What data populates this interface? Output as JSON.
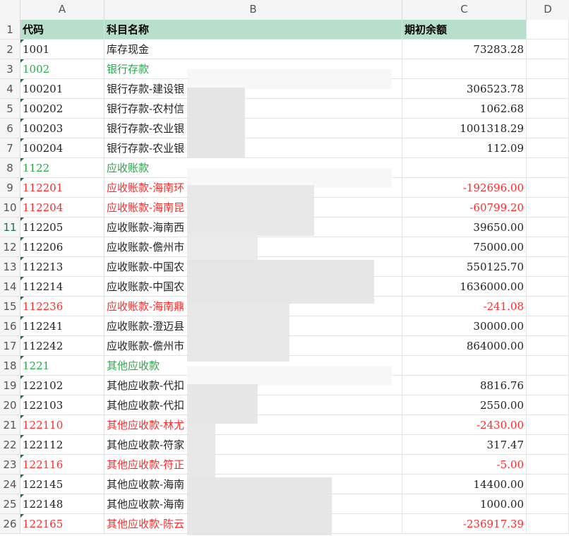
{
  "columns": [
    "A",
    "B",
    "C",
    "D"
  ],
  "header": {
    "row": "1",
    "code": "代码",
    "name": "科目名称",
    "balance": "期初余额"
  },
  "rows": [
    {
      "n": "2",
      "code": "1001",
      "name": "库存现金",
      "bal": "73283.28",
      "style": ""
    },
    {
      "n": "3",
      "code": "1002",
      "name": "银行存款",
      "bal": "",
      "style": "green"
    },
    {
      "n": "4",
      "code": "100201",
      "name": "银行存款-建设银",
      "bal": "306523.78",
      "style": ""
    },
    {
      "n": "5",
      "code": "100202",
      "name": "银行存款-农村信",
      "bal": "1062.68",
      "style": ""
    },
    {
      "n": "6",
      "code": "100203",
      "name": "银行存款-农业银",
      "bal": "1001318.29",
      "style": ""
    },
    {
      "n": "7",
      "code": "100204",
      "name": "银行存款-农业银",
      "bal": "112.09",
      "style": ""
    },
    {
      "n": "8",
      "code": "1122",
      "name": "应收账款",
      "bal": "",
      "style": "green"
    },
    {
      "n": "9",
      "code": "112201",
      "name": "应收账款-海南环",
      "bal": "-192696.00",
      "style": "red"
    },
    {
      "n": "10",
      "code": "112204",
      "name": "应收账款-海南昆",
      "bal": "-60799.20",
      "style": "red"
    },
    {
      "n": "11",
      "code": "112205",
      "name": "应收账款-海南西",
      "bal": "39650.00",
      "style": ""
    },
    {
      "n": "12",
      "code": "112206",
      "name": "应收账款-儋州市",
      "bal": "75000.00",
      "style": ""
    },
    {
      "n": "13",
      "code": "112213",
      "name": "应收账款-中国农",
      "bal": "550125.70",
      "style": ""
    },
    {
      "n": "14",
      "code": "112214",
      "name": "应收账款-中国农",
      "bal": "1636000.00",
      "style": ""
    },
    {
      "n": "15",
      "code": "112236",
      "name": "应收账款-海南鼎",
      "bal": "-241.08",
      "style": "red"
    },
    {
      "n": "16",
      "code": "112241",
      "name": "应收账款-澄迈县",
      "bal": "30000.00",
      "style": ""
    },
    {
      "n": "17",
      "code": "112242",
      "name": "应收账款-儋州市",
      "bal": "864000.00",
      "style": ""
    },
    {
      "n": "18",
      "code": "1221",
      "name": "其他应收款",
      "bal": "",
      "style": "green"
    },
    {
      "n": "19",
      "code": "122102",
      "name": "其他应收款-代扣",
      "bal": "8816.76",
      "style": ""
    },
    {
      "n": "20",
      "code": "122103",
      "name": "其他应收款-代扣",
      "bal": "2550.00",
      "style": ""
    },
    {
      "n": "21",
      "code": "122110",
      "name": "其他应收款-林尤",
      "bal": "-2430.00",
      "style": "red"
    },
    {
      "n": "22",
      "code": "122112",
      "name": "其他应收款-符家",
      "bal": "317.47",
      "style": ""
    },
    {
      "n": "23",
      "code": "122116",
      "name": "其他应收款-符正",
      "bal": "-5.00",
      "style": "red"
    },
    {
      "n": "24",
      "code": "122145",
      "name": "其他应收款-海南",
      "bal": "14400.00",
      "style": ""
    },
    {
      "n": "25",
      "code": "122148",
      "name": "其他应收款-海南",
      "bal": "1000.00",
      "style": ""
    },
    {
      "n": "26",
      "code": "122165",
      "name": "其他应收款-陈云",
      "bal": "-236917.39",
      "style": "red"
    }
  ],
  "selected_row": "11"
}
